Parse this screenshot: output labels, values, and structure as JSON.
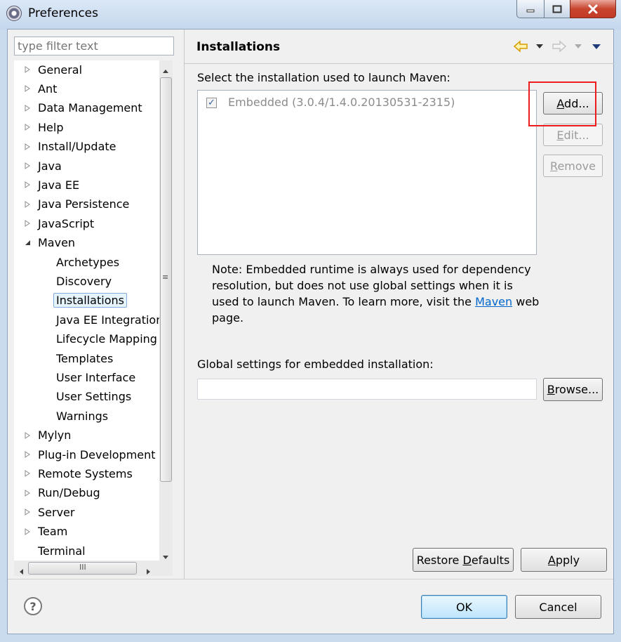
{
  "window": {
    "title": "Preferences",
    "controls": [
      "minimize-icon",
      "maximize-icon",
      "close-icon"
    ]
  },
  "filter": {
    "placeholder": "type filter text"
  },
  "tree": {
    "items": [
      {
        "label": "General",
        "expander": "collapsed"
      },
      {
        "label": "Ant",
        "expander": "collapsed"
      },
      {
        "label": "Data Management",
        "expander": "collapsed"
      },
      {
        "label": "Help",
        "expander": "collapsed"
      },
      {
        "label": "Install/Update",
        "expander": "collapsed"
      },
      {
        "label": "Java",
        "expander": "collapsed"
      },
      {
        "label": "Java EE",
        "expander": "collapsed"
      },
      {
        "label": "Java Persistence",
        "expander": "collapsed"
      },
      {
        "label": "JavaScript",
        "expander": "collapsed"
      },
      {
        "label": "Maven",
        "expander": "expanded"
      },
      {
        "label": "Archetypes"
      },
      {
        "label": "Discovery"
      },
      {
        "label": "Installations",
        "selected": true
      },
      {
        "label": "Java EE Integration"
      },
      {
        "label": "Lifecycle Mapping"
      },
      {
        "label": "Templates"
      },
      {
        "label": "User Interface"
      },
      {
        "label": "User Settings"
      },
      {
        "label": "Warnings"
      },
      {
        "label": "Mylyn",
        "expander": "collapsed"
      },
      {
        "label": "Plug-in Development",
        "expander": "collapsed"
      },
      {
        "label": "Remote Systems",
        "expander": "collapsed"
      },
      {
        "label": "Run/Debug",
        "expander": "collapsed"
      },
      {
        "label": "Server",
        "expander": "collapsed"
      },
      {
        "label": "Team",
        "expander": "collapsed"
      },
      {
        "label": "Terminal"
      }
    ]
  },
  "page": {
    "title": "Installations",
    "nav_icons": [
      "back-arrow-icon",
      "back-menu-icon",
      "forward-arrow-icon",
      "forward-menu-icon",
      "view-menu-icon"
    ],
    "select_label": "Select the installation used to launch Maven:",
    "installations": [
      {
        "label": "Embedded (3.0.4/1.4.0.20130531-2315)",
        "checked": true
      }
    ],
    "buttons": {
      "add": {
        "mnemonic": "A",
        "rest": "dd..."
      },
      "edit": {
        "mnemonic": "E",
        "rest": "dit..."
      },
      "remove": {
        "mnemonic": "R",
        "rest": "emove"
      },
      "browse": {
        "mnemonic": "B",
        "rest": "rowse..."
      }
    },
    "note_text": "Note: Embedded runtime is always used for dependency resolution, but does not use global settings when it is used to launch Maven. To learn more, visit the",
    "note_link": "Maven",
    "note_suffix": "web page.",
    "global_settings_label": "Global settings for embedded installation:",
    "global_settings_value": "",
    "restore_defaults": {
      "before": "Restore ",
      "mnemonic": "D",
      "after": "efaults"
    },
    "apply": {
      "mnemonic": "A",
      "rest": "pply"
    }
  },
  "footer": {
    "help_glyph": "?",
    "ok": "OK",
    "cancel": "Cancel"
  },
  "colors": {
    "title_gradient": "#c4d7ed",
    "close_button": "#c7452f",
    "selection_border": "#84acdd",
    "highlight_box": "#ee1c1c",
    "link": "#0066cc"
  }
}
